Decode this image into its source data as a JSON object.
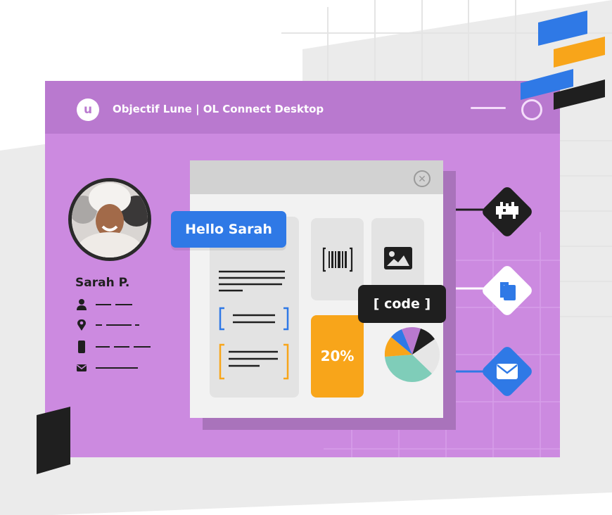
{
  "app": {
    "title": "Objectif Lune  |  OL Connect Desktop",
    "logo_letter": "u"
  },
  "profile": {
    "name": "Sarah P.",
    "fields": [
      {
        "icon": "user-icon"
      },
      {
        "icon": "location-pin-icon"
      },
      {
        "icon": "phone-icon"
      },
      {
        "icon": "envelope-icon"
      }
    ]
  },
  "document": {
    "greeting": "Hello Sarah",
    "code_tag": "[ code ]",
    "discount": "20%",
    "elements": [
      "barcode-icon",
      "image-icon",
      "pie-chart"
    ]
  },
  "outputs": [
    {
      "icon": "print-icon",
      "color": "#1f1f1f"
    },
    {
      "icon": "copy-icon",
      "color": "#ffffff"
    },
    {
      "icon": "mail-icon",
      "color": "#2f79e6"
    }
  ],
  "colors": {
    "window": "#cc8ae0",
    "titlebar": "#b979cf",
    "blue": "#2f79e6",
    "orange": "#f8a51a",
    "dark": "#1f1f1f",
    "teal": "#7fcdb9"
  }
}
